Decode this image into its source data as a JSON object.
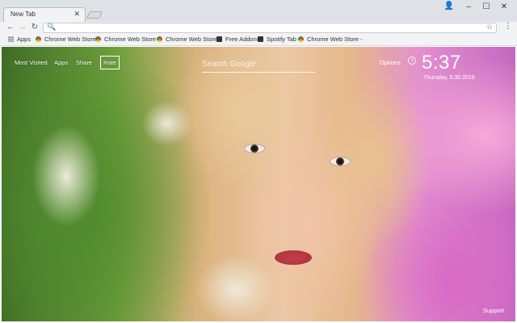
{
  "browser": {
    "tab": {
      "title": "New Tab",
      "close": "✕"
    },
    "window_controls": {
      "user": "👤",
      "minimize": "–",
      "maximize": "☐",
      "close": "✕"
    },
    "toolbar": {
      "back": "←",
      "forward": "→",
      "reload": "↻",
      "search_icon": "🔍",
      "star": "☆",
      "menu": "⋮",
      "url": ""
    }
  },
  "bookmarks": [
    {
      "label": "Apps",
      "icon": "apps-grid-icon"
    },
    {
      "label": "Chrome Web Store -",
      "icon": "chrome-web-store-icon"
    },
    {
      "label": "Chrome Web Store -",
      "icon": "chrome-web-store-icon"
    },
    {
      "label": "Chrome Web Store -",
      "icon": "chrome-web-store-icon"
    },
    {
      "label": "Free Addons",
      "icon": "free-addons-icon"
    },
    {
      "label": "Spotify Tab",
      "icon": "spotify-tab-icon"
    },
    {
      "label": "Chrome Web Store -",
      "icon": "chrome-web-store-icon"
    }
  ],
  "newtab": {
    "nav": {
      "most_visited": "Most Visited",
      "apps": "Apps",
      "share": "Share",
      "rate": "Rate"
    },
    "search_placeholder": "Search Google",
    "options": "Options",
    "time": "5:37",
    "date": "Thursday, 5.30.2019",
    "support": "Support"
  },
  "colors": {
    "tab_strip": "#dee1e6",
    "toolbar": "#f1f3f4",
    "overlay_text": "#ffffff"
  }
}
